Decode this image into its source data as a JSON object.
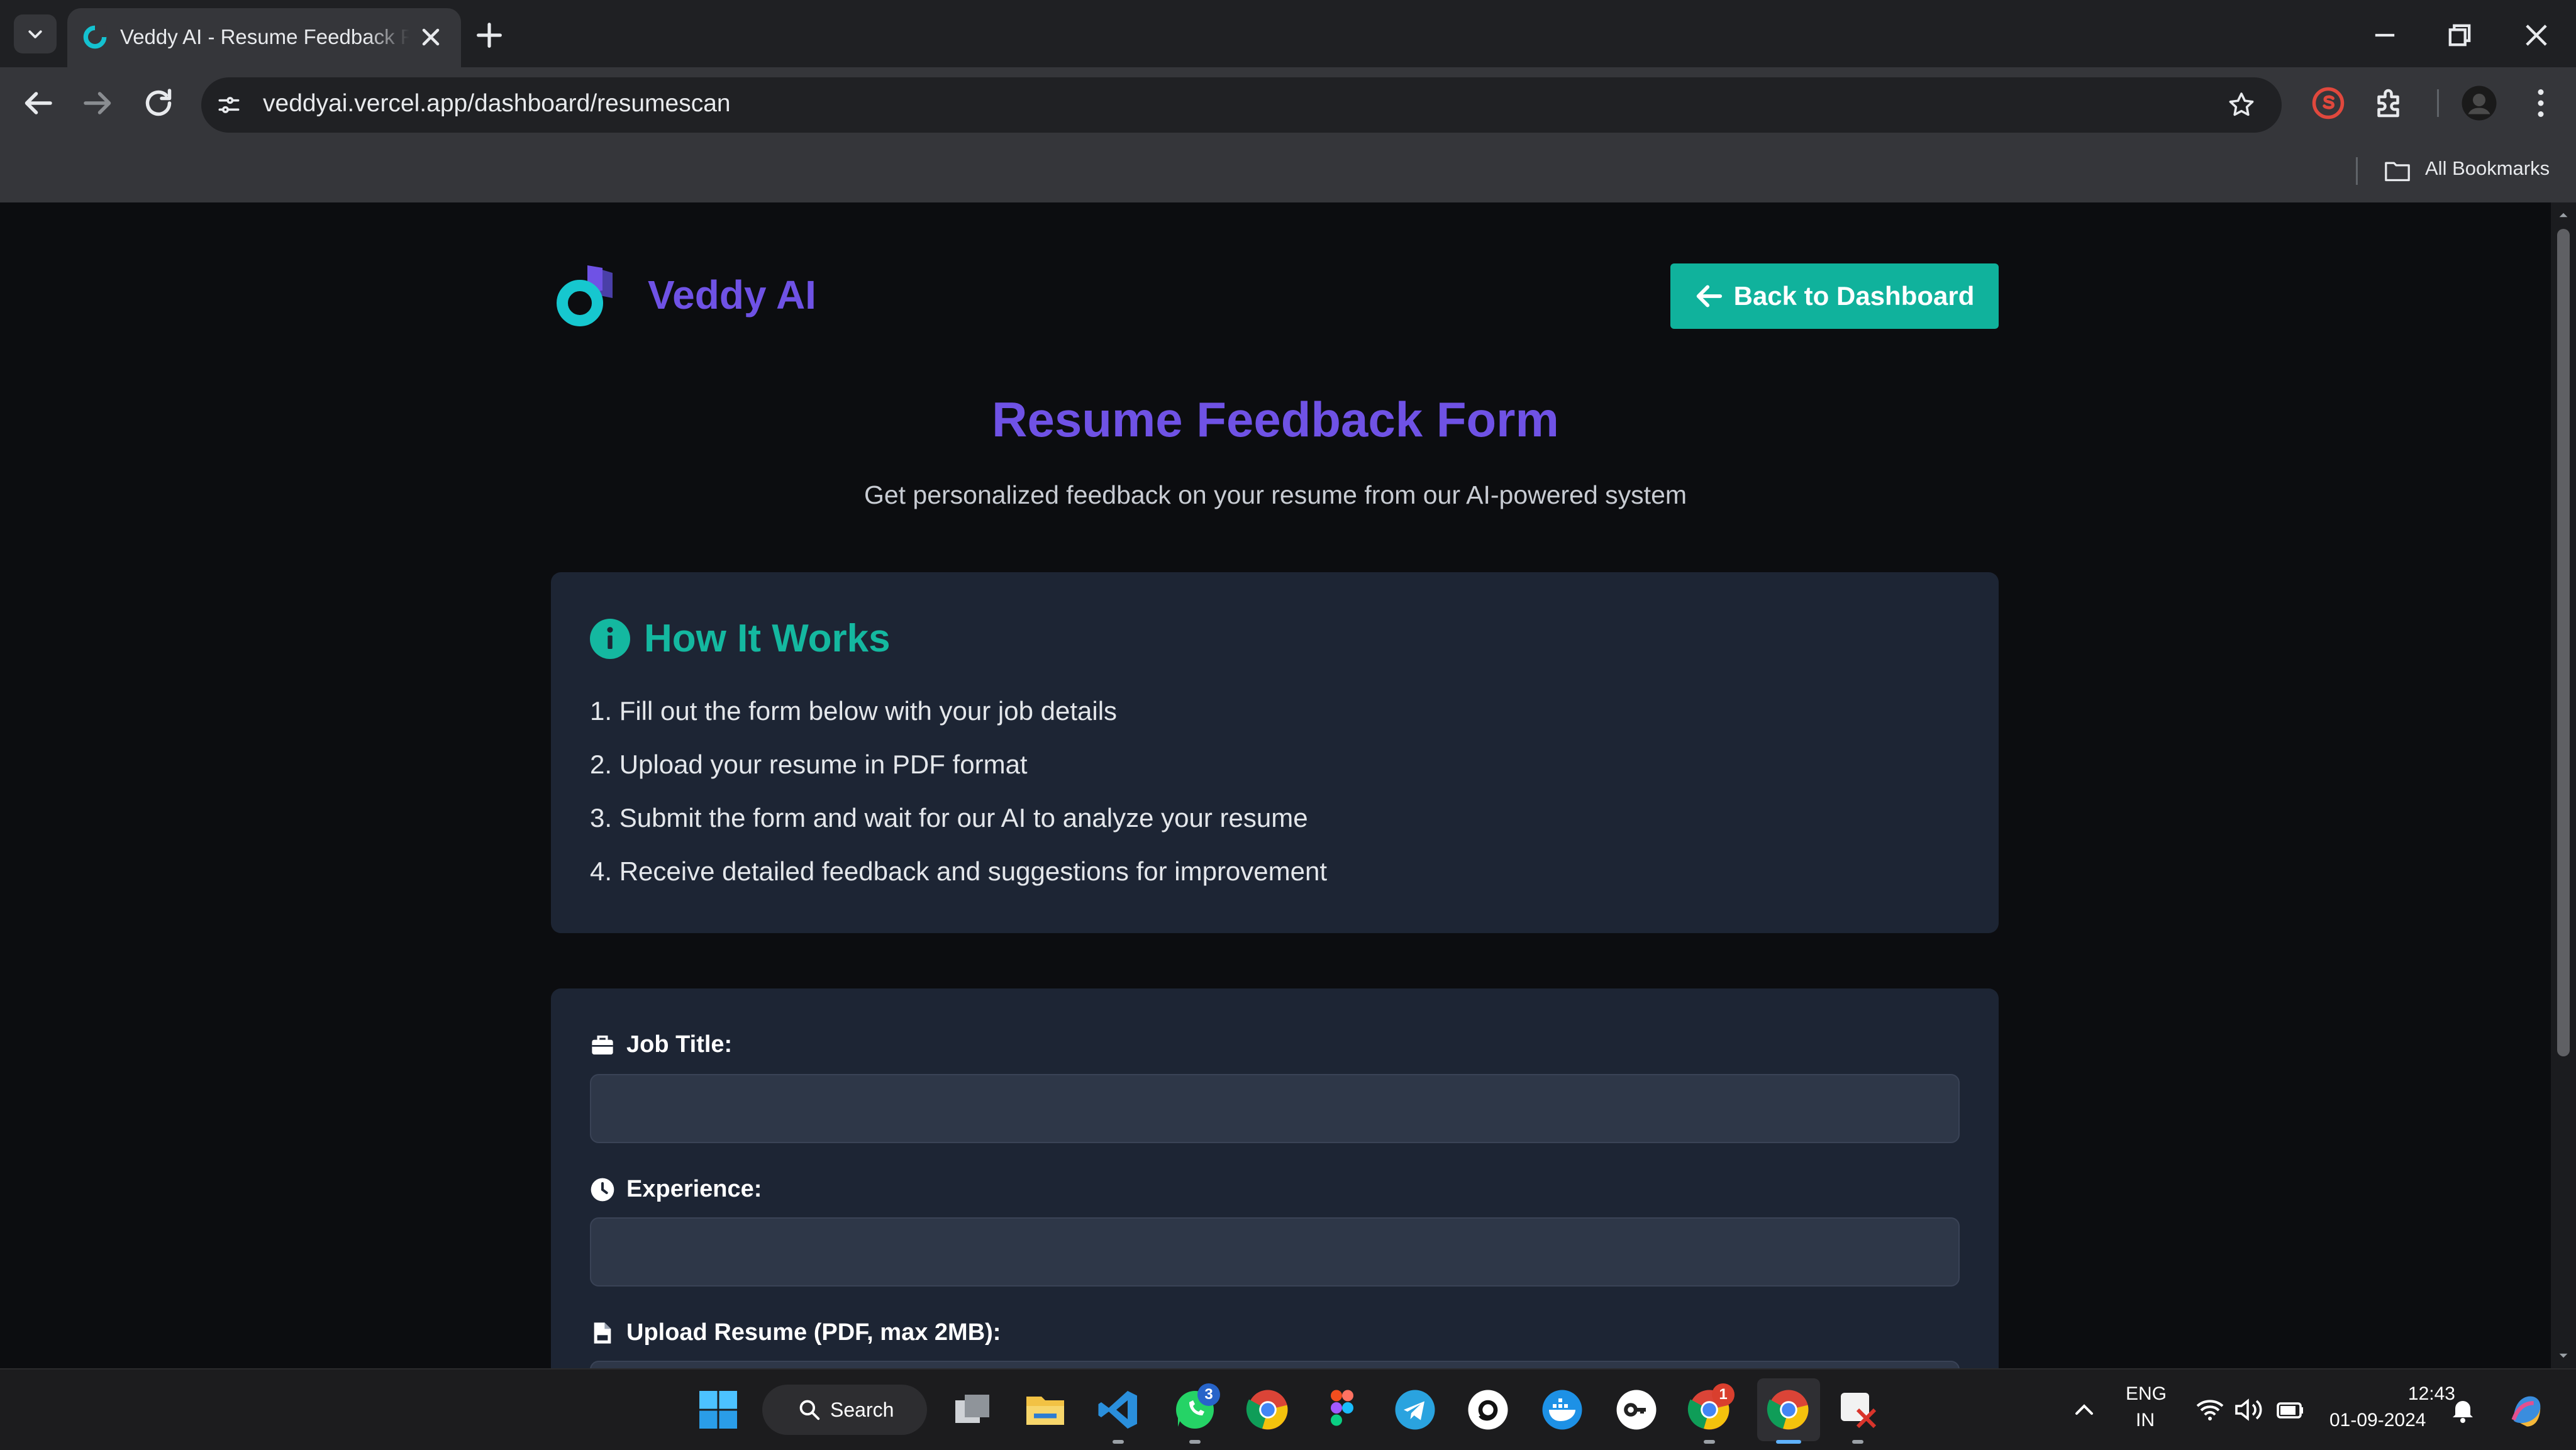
{
  "browser": {
    "tab_title": "Veddy AI - Resume Feedback Form",
    "url": "veddyai.vercel.app/dashboard/resumescan",
    "bookmarks_label": "All Bookmarks"
  },
  "page": {
    "brand_name": "Veddy AI",
    "back_button_label": "Back to Dashboard",
    "title": "Resume Feedback Form",
    "subtitle": "Get personalized feedback on your resume from our AI-powered system",
    "how_it_works": {
      "heading": "How It Works",
      "steps": [
        "1. Fill out the form below with your job details",
        "2. Upload your resume in PDF format",
        "3. Submit the form and wait for our AI to analyze your resume",
        "4. Receive detailed feedback and suggestions for improvement"
      ]
    },
    "form": {
      "job_title_label": "Job Title:",
      "job_title_value": "",
      "experience_label": "Experience:",
      "experience_value": "",
      "upload_label": "Upload Resume (PDF, max 2MB):"
    }
  },
  "taskbar": {
    "search_label": "Search",
    "whatsapp_badge": "3",
    "chrome_badge": "1",
    "language": "ENG",
    "region": "IN",
    "time": "12:43",
    "date": "01-09-2024"
  },
  "colors": {
    "accent_purple": "#6f52e5",
    "accent_teal": "#10b29c",
    "card_bg": "#1d2534",
    "page_bg": "#0c0d10"
  },
  "icons": {
    "tab_favicon": "veddy-logo-icon",
    "info": "info-circle-icon",
    "job_title": "briefcase-icon",
    "experience": "clock-icon",
    "upload": "file-pdf-icon"
  }
}
